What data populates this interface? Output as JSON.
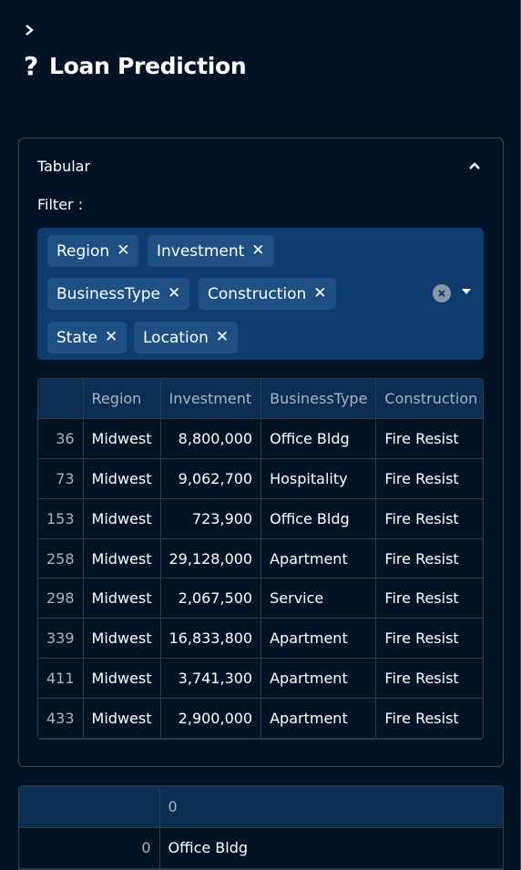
{
  "page": {
    "title": "Loan Prediction"
  },
  "icons": {
    "sidebar_toggle": "chevron-right-icon",
    "title": "question-mark-icon",
    "expander_toggle": "chevron-up-icon"
  },
  "expander": {
    "label": "Tabular"
  },
  "filter": {
    "label": "Filter :",
    "chips": [
      "Region",
      "Investment",
      "BusinessType",
      "Construction",
      "State",
      "Location"
    ]
  },
  "table": {
    "columns": [
      "",
      "Region",
      "Investment",
      "BusinessType",
      "Construction"
    ],
    "rows": [
      [
        "36",
        "Midwest",
        "8,800,000",
        "Office Bldg",
        "Fire Resist"
      ],
      [
        "73",
        "Midwest",
        "9,062,700",
        "Hospitality",
        "Fire Resist"
      ],
      [
        "153",
        "Midwest",
        "723,900",
        "Office Bldg",
        "Fire Resist"
      ],
      [
        "258",
        "Midwest",
        "29,128,000",
        "Apartment",
        "Fire Resist"
      ],
      [
        "298",
        "Midwest",
        "2,067,500",
        "Service",
        "Fire Resist"
      ],
      [
        "339",
        "Midwest",
        "16,833,800",
        "Apartment",
        "Fire Resist"
      ],
      [
        "411",
        "Midwest",
        "3,741,300",
        "Apartment",
        "Fire Resist"
      ],
      [
        "433",
        "Midwest",
        "2,900,000",
        "Apartment",
        "Fire Resist"
      ]
    ]
  },
  "result_table": {
    "columns": [
      "",
      "0"
    ],
    "rows": [
      [
        "0",
        "Office Bldg"
      ]
    ]
  }
}
